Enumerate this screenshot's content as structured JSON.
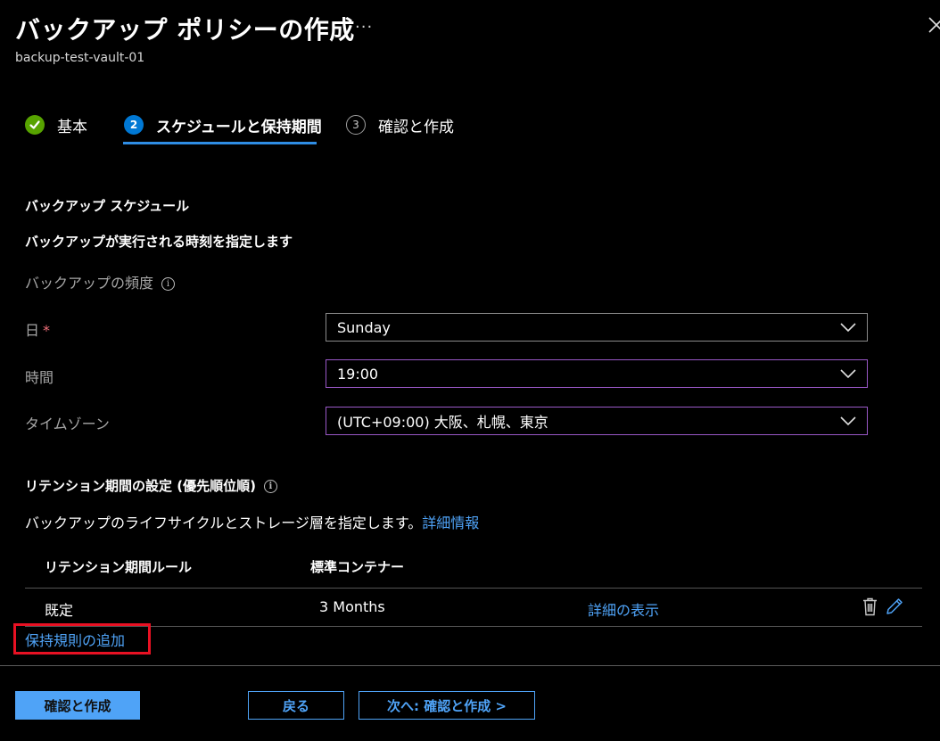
{
  "header": {
    "title": "バックアップ ポリシーの作成",
    "more_label": "···",
    "subtitle": "backup-test-vault-01"
  },
  "tabs": [
    {
      "label": "基本",
      "badge": "",
      "state": "completed"
    },
    {
      "label": "スケジュールと保持期間",
      "badge": "2",
      "state": "active"
    },
    {
      "label": "確認と作成",
      "badge": "3",
      "state": "pending"
    }
  ],
  "schedule": {
    "section_title": "バックアップ スケジュール",
    "description": "バックアップが実行される時刻を指定します",
    "frequency_label": "バックアップの頻度",
    "day_label": "日",
    "required_mark": "*",
    "day_value": "Sunday",
    "time_label": "時間",
    "time_value": "19:00",
    "timezone_label": "タイムゾーン",
    "timezone_value": "(UTC+09:00) 大阪、札幌、東京"
  },
  "retention": {
    "section_title": "リテンション期間の設定 (優先順位順)",
    "description": "バックアップのライフサイクルとストレージ層を指定します。",
    "learn_more": "詳細情報",
    "columns": [
      "リテンション期間ルール",
      "標準コンテナー"
    ],
    "rows": [
      {
        "rule": "既定",
        "value": "3 Months",
        "details_link": "詳細の表示"
      }
    ],
    "add_rule": "保持規則の追加"
  },
  "footer": {
    "review_create": "確認と作成",
    "back": "戻る",
    "next": "次へ: 確認と作成 >"
  },
  "colors": {
    "accent": "#4fa3f7",
    "completed": "#57a300",
    "active_tab": "#0078d4",
    "highlight": "#e81123",
    "focus_border": "#9a58c7"
  }
}
